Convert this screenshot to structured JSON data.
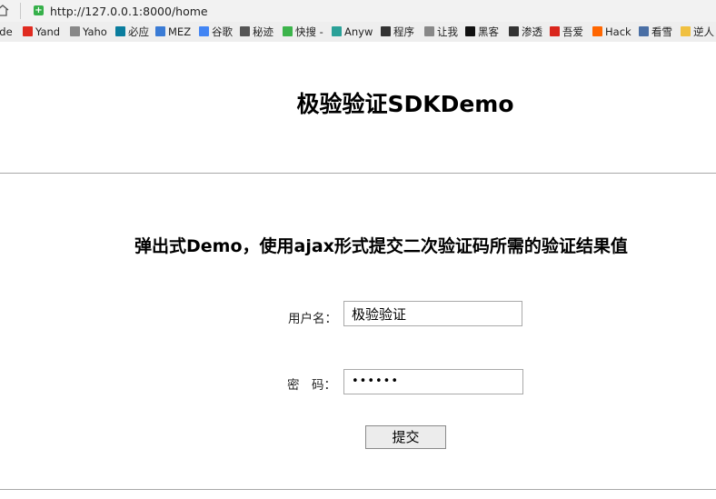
{
  "browser": {
    "url": "http://127.0.0.1:8000/home",
    "bookmarks": [
      {
        "label": "ude",
        "icon": "none"
      },
      {
        "label": "Yand",
        "icon": "yandex-icon",
        "color": "#e02b20"
      },
      {
        "label": "Yaho",
        "icon": "page-icon",
        "color": "#888888"
      },
      {
        "label": "必应",
        "icon": "bing-icon",
        "color": "#0a7d9e"
      },
      {
        "label": "MEZ",
        "icon": "mez-icon",
        "color": "#3a7bd5"
      },
      {
        "label": "谷歌",
        "icon": "google-icon",
        "color": "#4285f4"
      },
      {
        "label": "秘迹",
        "icon": "circle-icon",
        "color": "#555555"
      },
      {
        "label": "快搜 -",
        "icon": "globe-icon",
        "color": "#3cb44b"
      },
      {
        "label": "Anyw",
        "icon": "anyw-icon",
        "color": "#2aa198"
      },
      {
        "label": "程序",
        "icon": "code-icon",
        "color": "#333333"
      },
      {
        "label": "让我",
        "icon": "page-icon",
        "color": "#888888"
      },
      {
        "label": "黑客",
        "icon": "hacker-icon",
        "color": "#111111"
      },
      {
        "label": "渗透",
        "icon": "skull-icon",
        "color": "#333333"
      },
      {
        "label": "吾爱",
        "icon": "grid-icon",
        "color": "#d9261c"
      },
      {
        "label": "Hack",
        "icon": "hack-icon",
        "color": "#ff6600"
      },
      {
        "label": "看雪",
        "icon": "snowflake-icon",
        "color": "#4a6fa5"
      },
      {
        "label": "逆人",
        "icon": "folder-icon",
        "color": "#f0c040"
      }
    ]
  },
  "page": {
    "title": "极验验证SDKDemo",
    "subtitle": "弹出式Demo，使用ajax形式提交二次验证码所需的验证结果值"
  },
  "form": {
    "username_label": "用户名：",
    "username_value": "极验验证",
    "password_label": "密　码：",
    "password_mask": "••••••",
    "submit_label": "提交"
  }
}
